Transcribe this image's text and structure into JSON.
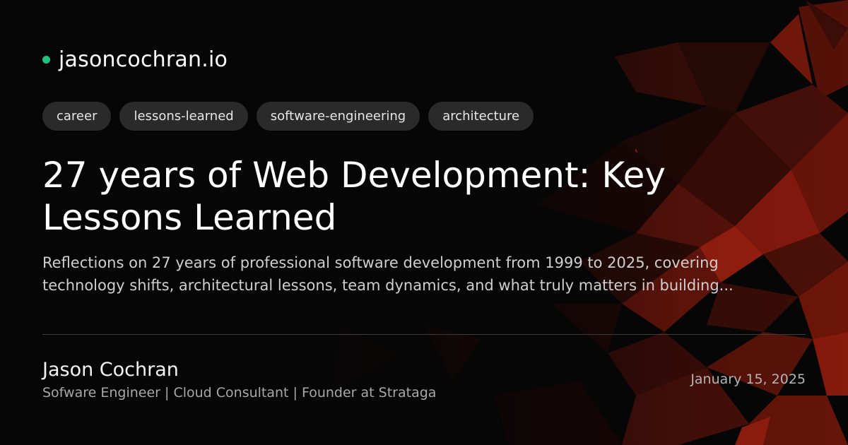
{
  "site": {
    "name": "jasoncochran.io",
    "dot_color": "#22c07a"
  },
  "tags": [
    "career",
    "lessons-learned",
    "software-engineering",
    "architecture"
  ],
  "post": {
    "title": "27 years of Web Development: Key Lessons Learned",
    "description": "Reflections on 27 years of professional software development from 1999 to 2025, covering technology shifts, architectural lessons, team dynamics, and what truly matters in building..."
  },
  "author": {
    "name": "Jason Cochran",
    "bio": "Sofware Engineer | Cloud Consultant | Founder at Strataga"
  },
  "date": "January 15, 2025",
  "colors": {
    "background": "#060606",
    "accent_red": "#8b1a0e",
    "tag_background": "#2a2a2a"
  }
}
